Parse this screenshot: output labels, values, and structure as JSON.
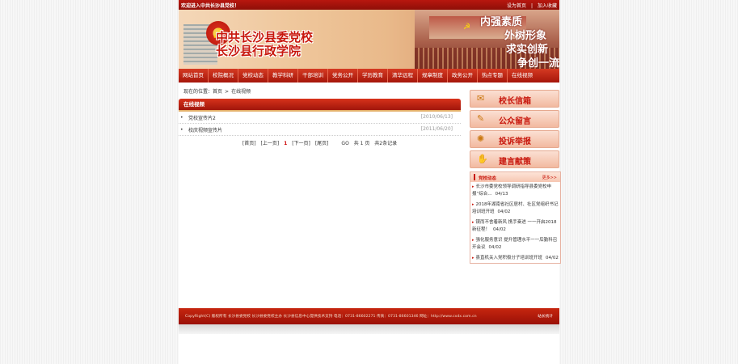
{
  "topbar": {
    "welcome": "欢迎进入中共长沙县党校！",
    "set_home": "设为首页",
    "add_fav": "加入收藏"
  },
  "banner": {
    "title_line1": "中共长沙县委党校",
    "title_line2": "长沙县行政学院",
    "slogans": [
      "内强素质",
      "外树形象",
      "求实创新",
      "争创一流"
    ]
  },
  "nav": {
    "items": [
      "网站首页",
      "校院概况",
      "党校动态",
      "教学科研",
      "干部培训",
      "党务公开",
      "学历教育",
      "清华远程",
      "规章制度",
      "政务公开",
      "热点专题",
      "在线视频"
    ]
  },
  "breadcrumb": {
    "prefix": "现在的位置：",
    "home": "首页",
    "separator": ">",
    "current": "在线视频"
  },
  "main": {
    "section_title": "在线视频",
    "rows": [
      {
        "title": "党校宣传片2",
        "date": "[2010/06/13]"
      },
      {
        "title": "校庆视频宣传片",
        "date": "[2011/06/20]"
      }
    ],
    "pager": {
      "first": "[首页]",
      "prev": "[上一页]",
      "current": "1",
      "next": "[下一页]",
      "last": "[尾页]",
      "goto": "GO",
      "total_pages": "共 1 页",
      "total_records": "共2条记录"
    }
  },
  "sidebar": {
    "buttons": [
      {
        "label": "校长信箱",
        "icon": "mailbox-icon",
        "glyph": "✉"
      },
      {
        "label": "公众留言",
        "icon": "message-icon",
        "glyph": "✎"
      },
      {
        "label": "投诉举报",
        "icon": "lightbulb-icon",
        "glyph": "💡"
      },
      {
        "label": "建言献策",
        "icon": "hand-icon",
        "glyph": "✋"
      }
    ],
    "news": {
      "title": "党校动态",
      "more": "更多>>",
      "items": [
        {
          "text": "长沙市委党校领导调研指导县委党校申报“综合...",
          "date": "04/13"
        },
        {
          "text": "2018年湖南省社区居村、社区党组织书记培训班开班",
          "date": "04/02"
        },
        {
          "text": "锲而不舍着新风 携手奋进 一一开启2018新征程！",
          "date": "04/02"
        },
        {
          "text": "强化服务意识 提升管理水平一一后勤科召开会议",
          "date": "04/02"
        },
        {
          "text": "县直机关入党积极分子培训班开班",
          "date": "04/02"
        }
      ]
    }
  },
  "footer": {
    "text": "CopyRight(C) 版权所有 长沙县委党校 长沙县委党校主办 长沙县信息中心提供技术支持 电话：0731-86602271 传真：0731-86601346 网址：http://www.cxdx.com.cn",
    "stats": "站长统计"
  },
  "colors": {
    "primary_red": "#c8170d",
    "nav_red": "#d53a22",
    "banner_gold": "#efc79c"
  }
}
